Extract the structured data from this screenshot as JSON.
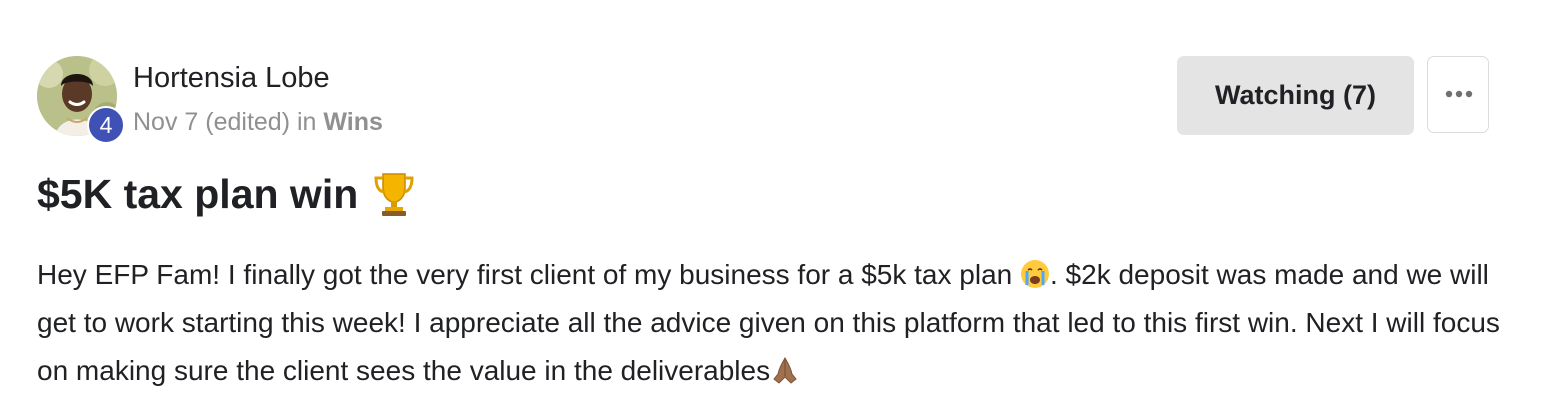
{
  "post": {
    "author": {
      "name": "Hortensia Lobe",
      "level": "4"
    },
    "meta": {
      "date": "Nov 7 (edited)",
      "in_word": "in",
      "category": "Wins"
    },
    "actions": {
      "watching_label": "Watching (7)",
      "more_icon": "ellipsis-icon"
    },
    "title": "$5K tax plan win",
    "title_icon": "trophy-icon",
    "body": {
      "part1": "Hey EFP Fam! I finally got the very first client of my business for a $5k tax plan ",
      "part2": ". $2k deposit was made and we will get to work starting this week! I appreciate all the advice given on this platform that led to this first win. Next I will focus on making sure the client sees the value in the deliverables",
      "emoji_1": "crying-face-icon",
      "emoji_2": "praying-hands-icon"
    }
  },
  "colors": {
    "badge": "#3f51b5",
    "button_bg": "#e4e4e4",
    "meta_text": "#909090"
  }
}
